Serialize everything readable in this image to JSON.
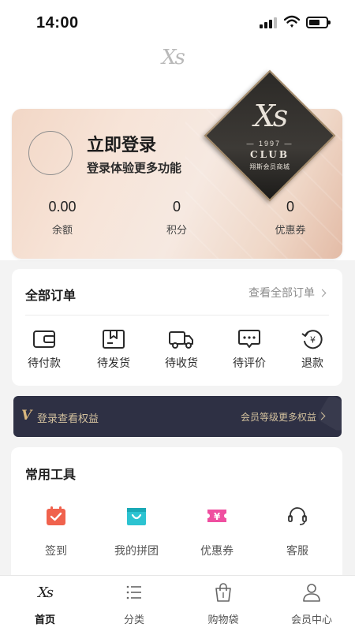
{
  "status_bar": {
    "time": "14:00"
  },
  "header": {
    "logo_text": "Xs"
  },
  "member_card": {
    "title": "立即登录",
    "subtitle": "登录体验更多功能",
    "stats": [
      {
        "value": "0.00",
        "label": "余额"
      },
      {
        "value": "0",
        "label": "积分"
      },
      {
        "value": "0",
        "label": "优惠券"
      }
    ],
    "badge": {
      "logo": "Xs",
      "year": "— 1997 —",
      "club": "CLUB",
      "name": "翔斯会员商城"
    }
  },
  "orders": {
    "title": "全部订单",
    "view_all": "查看全部订单",
    "items": [
      {
        "label": "待付款",
        "icon": "wallet-icon"
      },
      {
        "label": "待发货",
        "icon": "package-icon"
      },
      {
        "label": "待收货",
        "icon": "truck-icon"
      },
      {
        "label": "待评价",
        "icon": "comment-icon"
      },
      {
        "label": "退款",
        "icon": "refund-icon"
      }
    ]
  },
  "vip": {
    "left_text": "登录查看权益",
    "right_text": "会员等级更多权益",
    "accent": "#d3c19e",
    "background": "#2e3044"
  },
  "tools": {
    "title": "常用工具",
    "items": [
      {
        "label": "签到",
        "icon": "calendar-check-icon",
        "color": "#f0624d"
      },
      {
        "label": "我的拼团",
        "icon": "group-bag-icon",
        "color": "#2cc3d1"
      },
      {
        "label": "优惠券",
        "icon": "coupon-icon",
        "color": "#ef4fa0"
      },
      {
        "label": "客服",
        "icon": "headset-icon",
        "color": "#333333"
      }
    ]
  },
  "tab_bar": {
    "items": [
      {
        "label": "首页",
        "icon": "home-xs-icon",
        "active": true
      },
      {
        "label": "分类",
        "icon": "list-icon",
        "active": false
      },
      {
        "label": "购物袋",
        "icon": "shopping-bag-icon",
        "active": false
      },
      {
        "label": "会员中心",
        "icon": "user-icon",
        "active": false
      }
    ]
  }
}
